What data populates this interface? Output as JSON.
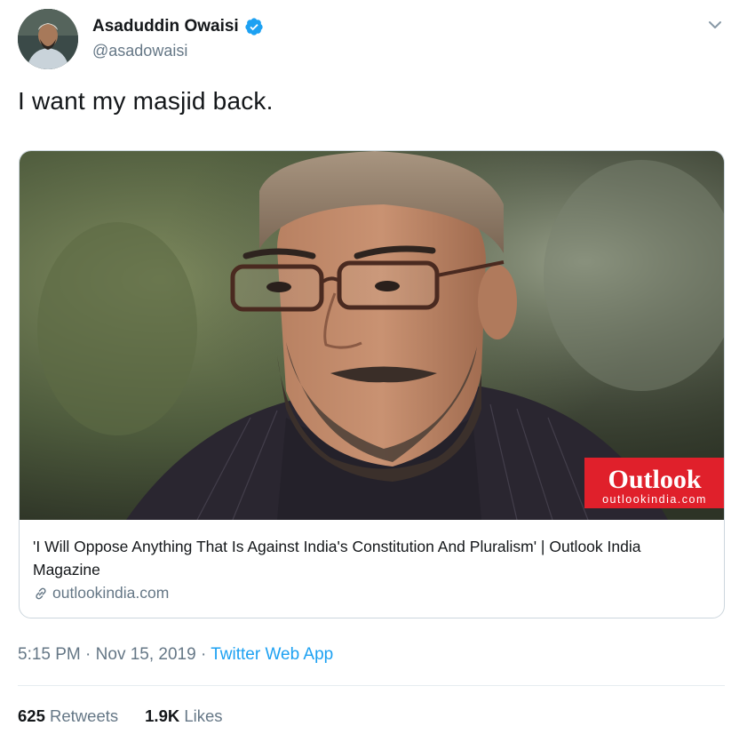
{
  "author": {
    "name": "Asaduddin Owaisi",
    "handle": "@asadowaisi",
    "verified": true
  },
  "tweet": {
    "text": "I want my masjid back."
  },
  "card": {
    "image_badge": {
      "brand": "Outlook",
      "domain": "outlookindia.com",
      "color": "#e0202b"
    },
    "title": "'I Will Oppose Anything That Is Against India's Constitution And Pluralism' | Outlook India Magazine",
    "domain": "outlookindia.com"
  },
  "meta": {
    "time": "5:15 PM",
    "separator": "·",
    "date": "Nov 15, 2019",
    "app": "Twitter Web App"
  },
  "stats": {
    "retweets_count": "625",
    "retweets_label": "Retweets",
    "likes_count": "1.9K",
    "likes_label": "Likes"
  },
  "colors": {
    "accent": "#1da1f2",
    "secondary_text": "#657786"
  }
}
